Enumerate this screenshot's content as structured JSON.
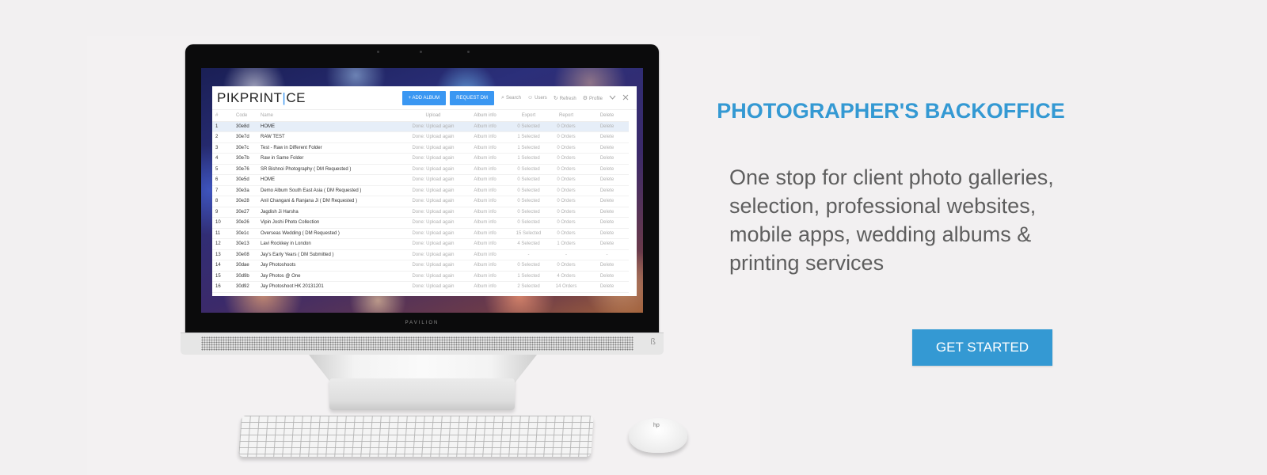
{
  "hero": {
    "title": "PHOTOGRAPHER'S BACKOFFICE",
    "description": "One stop for client photo galleries, selection, professional websites, mobile apps, wedding albums & printing services",
    "cta_label": "GET STARTED"
  },
  "colors": {
    "accent": "#3499d3",
    "app_button": "#3a97f2",
    "page_background": "#f2f0f1"
  },
  "device": {
    "brand": "PAVILION"
  },
  "app": {
    "logo_left": "PIKPRINT",
    "logo_bar": "|",
    "logo_right": "CE",
    "add_album": "+ ADD ALBUM",
    "request_dm": "REQUEST DM",
    "nav": [
      {
        "icon": "search-icon",
        "glyph": "⌕",
        "label": "Search"
      },
      {
        "icon": "user-icon",
        "glyph": "☺",
        "label": "Users"
      },
      {
        "icon": "refresh-icon",
        "glyph": "↻",
        "label": "Refresh"
      },
      {
        "icon": "gear-icon",
        "glyph": "⚙",
        "label": "Profile"
      }
    ],
    "columns": [
      "#",
      "Code",
      "Name",
      "Upload",
      "Album info",
      "Export",
      "Report",
      "Delete"
    ],
    "rows": [
      {
        "num": "1",
        "code": "30e8d",
        "name": "HOME",
        "upload": "Done: Upload again",
        "info": "Album info",
        "export": "0 Selected",
        "report": "0 Orders",
        "delete": "Delete"
      },
      {
        "num": "2",
        "code": "30e7d",
        "name": "RAW TEST",
        "upload": "Done: Upload again",
        "info": "Album info",
        "export": "1 Selected",
        "report": "0 Orders",
        "delete": "Delete"
      },
      {
        "num": "3",
        "code": "30e7c",
        "name": "Test - Raw in Different Folder",
        "upload": "Done: Upload again",
        "info": "Album info",
        "export": "1 Selected",
        "report": "0 Orders",
        "delete": "Delete"
      },
      {
        "num": "4",
        "code": "30e7b",
        "name": "Raw in Same Folder",
        "upload": "Done: Upload again",
        "info": "Album info",
        "export": "1 Selected",
        "report": "0 Orders",
        "delete": "Delete"
      },
      {
        "num": "5",
        "code": "30e76",
        "name": "SR Bishnoi Photography ( DM Requested )",
        "upload": "Done: Upload again",
        "info": "Album info",
        "export": "0 Selected",
        "report": "0 Orders",
        "delete": "Delete"
      },
      {
        "num": "6",
        "code": "30e5d",
        "name": "HOME",
        "upload": "Done: Upload again",
        "info": "Album info",
        "export": "0 Selected",
        "report": "0 Orders",
        "delete": "Delete"
      },
      {
        "num": "7",
        "code": "30e3a",
        "name": "Demo Album South East Asia ( DM Requested )",
        "upload": "Done: Upload again",
        "info": "Album info",
        "export": "0 Selected",
        "report": "0 Orders",
        "delete": "Delete"
      },
      {
        "num": "8",
        "code": "30e28",
        "name": "Anil Changani & Ranjana Ji ( DM Requested )",
        "upload": "Done: Upload again",
        "info": "Album info",
        "export": "0 Selected",
        "report": "0 Orders",
        "delete": "Delete"
      },
      {
        "num": "9",
        "code": "30e27",
        "name": "Jagdish Ji Harsha",
        "upload": "Done: Upload again",
        "info": "Album info",
        "export": "0 Selected",
        "report": "0 Orders",
        "delete": "Delete"
      },
      {
        "num": "10",
        "code": "30e26",
        "name": "Vipin Joshi Photo Collection",
        "upload": "Done: Upload again",
        "info": "Album info",
        "export": "0 Selected",
        "report": "0 Orders",
        "delete": "Delete"
      },
      {
        "num": "11",
        "code": "30e1c",
        "name": "Overseas Wedding ( DM Requested )",
        "upload": "Done: Upload again",
        "info": "Album info",
        "export": "15 Selected",
        "report": "0 Orders",
        "delete": "Delete"
      },
      {
        "num": "12",
        "code": "30e13",
        "name": "Lavi Rockkey in London",
        "upload": "Done: Upload again",
        "info": "Album info",
        "export": "4 Selected",
        "report": "1 Orders",
        "delete": "Delete"
      },
      {
        "num": "13",
        "code": "30e08",
        "name": "Jay's Early Years ( DM Submitted )",
        "upload": "Done: Upload again",
        "info": "Album info",
        "export": "-",
        "report": "-",
        "delete": "-"
      },
      {
        "num": "14",
        "code": "30dae",
        "name": "Jay Photoshoots",
        "upload": "Done: Upload again",
        "info": "Album info",
        "export": "0 Selected",
        "report": "0 Orders",
        "delete": "Delete"
      },
      {
        "num": "15",
        "code": "30d9b",
        "name": "Jay Photos @ One",
        "upload": "Done: Upload again",
        "info": "Album info",
        "export": "1 Selected",
        "report": "4 Orders",
        "delete": "Delete"
      },
      {
        "num": "16",
        "code": "30d92",
        "name": "Jay Photoshoot HK 20131201",
        "upload": "Done: Upload again",
        "info": "Album info",
        "export": "2 Selected",
        "report": "14 Orders",
        "delete": "Delete"
      }
    ]
  }
}
